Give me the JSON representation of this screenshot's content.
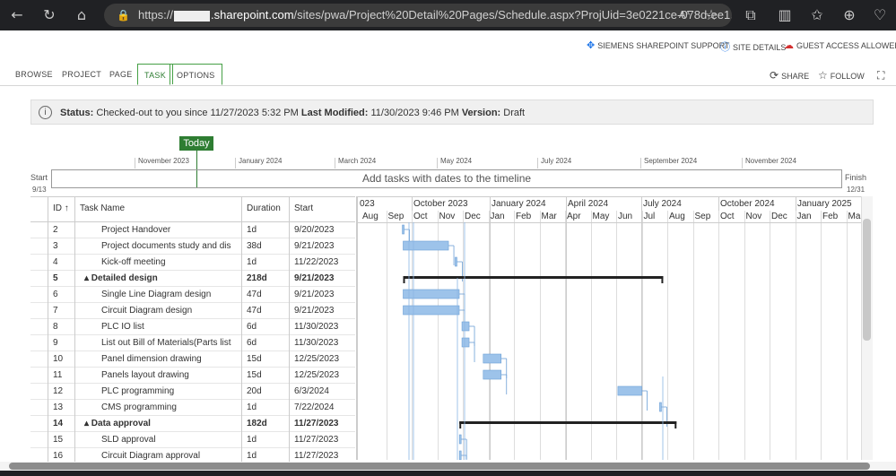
{
  "browser": {
    "url_prefix": "https://",
    "url_host": ".sharepoint.com",
    "url_path": "/sites/pwa/Project%20Detail%20Pages/Schedule.aspx?ProjUid=3e0221ce-078d-ee1..."
  },
  "top_links": {
    "support": "SIEMENS SHAREPOINT SUPPORT",
    "site_details": "SITE DETAILS",
    "guest_access": "GUEST ACCESS ALLOWED"
  },
  "ribbon": {
    "tabs": [
      "BROWSE",
      "PROJECT",
      "PAGE",
      "TASK",
      "OPTIONS"
    ],
    "share": "SHARE",
    "follow": "FOLLOW"
  },
  "status_bar": {
    "status_label": "Status:",
    "status_value": "Checked-out to you since 11/27/2023 5:32 PM",
    "modified_label": "Last Modified:",
    "modified_value": "11/30/2023 9:46 PM",
    "version_label": "Version:",
    "version_value": "Draft"
  },
  "timeline": {
    "today": "Today",
    "months": [
      "November 2023",
      "January 2024",
      "March 2024",
      "May 2024",
      "July 2024",
      "September 2024",
      "November 2024"
    ],
    "placeholder": "Add tasks with dates to the timeline",
    "start_label": "Start",
    "start_date": "9/13",
    "finish_label": "Finish",
    "finish_date": "12/31"
  },
  "grid": {
    "headers": {
      "id": "ID ↑",
      "name": "Task Name",
      "duration": "Duration",
      "start": "Start"
    },
    "rows": [
      {
        "id": "2",
        "name": "Project Handover",
        "duration": "1d",
        "start": "9/20/2023",
        "summary": false
      },
      {
        "id": "3",
        "name": "Project documents study and dis",
        "duration": "38d",
        "start": "9/21/2023",
        "summary": false
      },
      {
        "id": "4",
        "name": "Kick-off meeting",
        "duration": "1d",
        "start": "11/22/2023",
        "summary": false
      },
      {
        "id": "5",
        "name": "▴ Detailed design",
        "duration": "218d",
        "start": "9/21/2023",
        "summary": true
      },
      {
        "id": "6",
        "name": "Single Line Diagram design",
        "duration": "47d",
        "start": "9/21/2023",
        "summary": false
      },
      {
        "id": "7",
        "name": "Circuit Diagram design",
        "duration": "47d",
        "start": "9/21/2023",
        "summary": false
      },
      {
        "id": "8",
        "name": "PLC IO list",
        "duration": "6d",
        "start": "11/30/2023",
        "summary": false
      },
      {
        "id": "9",
        "name": "List out Bill of Materials(Parts list",
        "duration": "6d",
        "start": "11/30/2023",
        "summary": false
      },
      {
        "id": "10",
        "name": "Panel dimension drawing",
        "duration": "15d",
        "start": "12/25/2023",
        "summary": false
      },
      {
        "id": "11",
        "name": "Panels layout drawing",
        "duration": "15d",
        "start": "12/25/2023",
        "summary": false
      },
      {
        "id": "12",
        "name": "PLC programming",
        "duration": "20d",
        "start": "6/3/2024",
        "summary": false
      },
      {
        "id": "13",
        "name": "CMS programming",
        "duration": "1d",
        "start": "7/22/2024",
        "summary": false
      },
      {
        "id": "14",
        "name": "▴ Data approval",
        "duration": "182d",
        "start": "11/27/2023",
        "summary": true
      },
      {
        "id": "15",
        "name": "SLD approval",
        "duration": "1d",
        "start": "11/27/2023",
        "summary": false
      },
      {
        "id": "16",
        "name": "Circuit Diagram approval",
        "duration": "1d",
        "start": "11/27/2023",
        "summary": false
      }
    ]
  },
  "gantt": {
    "top_months": [
      "023",
      "October 2023",
      "January 2024",
      "April 2024",
      "July 2024",
      "October 2024",
      "January 2025"
    ],
    "months": [
      "Aug",
      "Sep",
      "Oct",
      "Nov",
      "Dec",
      "Jan",
      "Feb",
      "Mar",
      "Apr",
      "May",
      "Jun",
      "Jul",
      "Aug",
      "Sep",
      "Oct",
      "Nov",
      "Dec",
      "Jan",
      "Feb",
      "Mar"
    ],
    "bar_color": "#9dc3ea",
    "summary_color": "#222222"
  }
}
